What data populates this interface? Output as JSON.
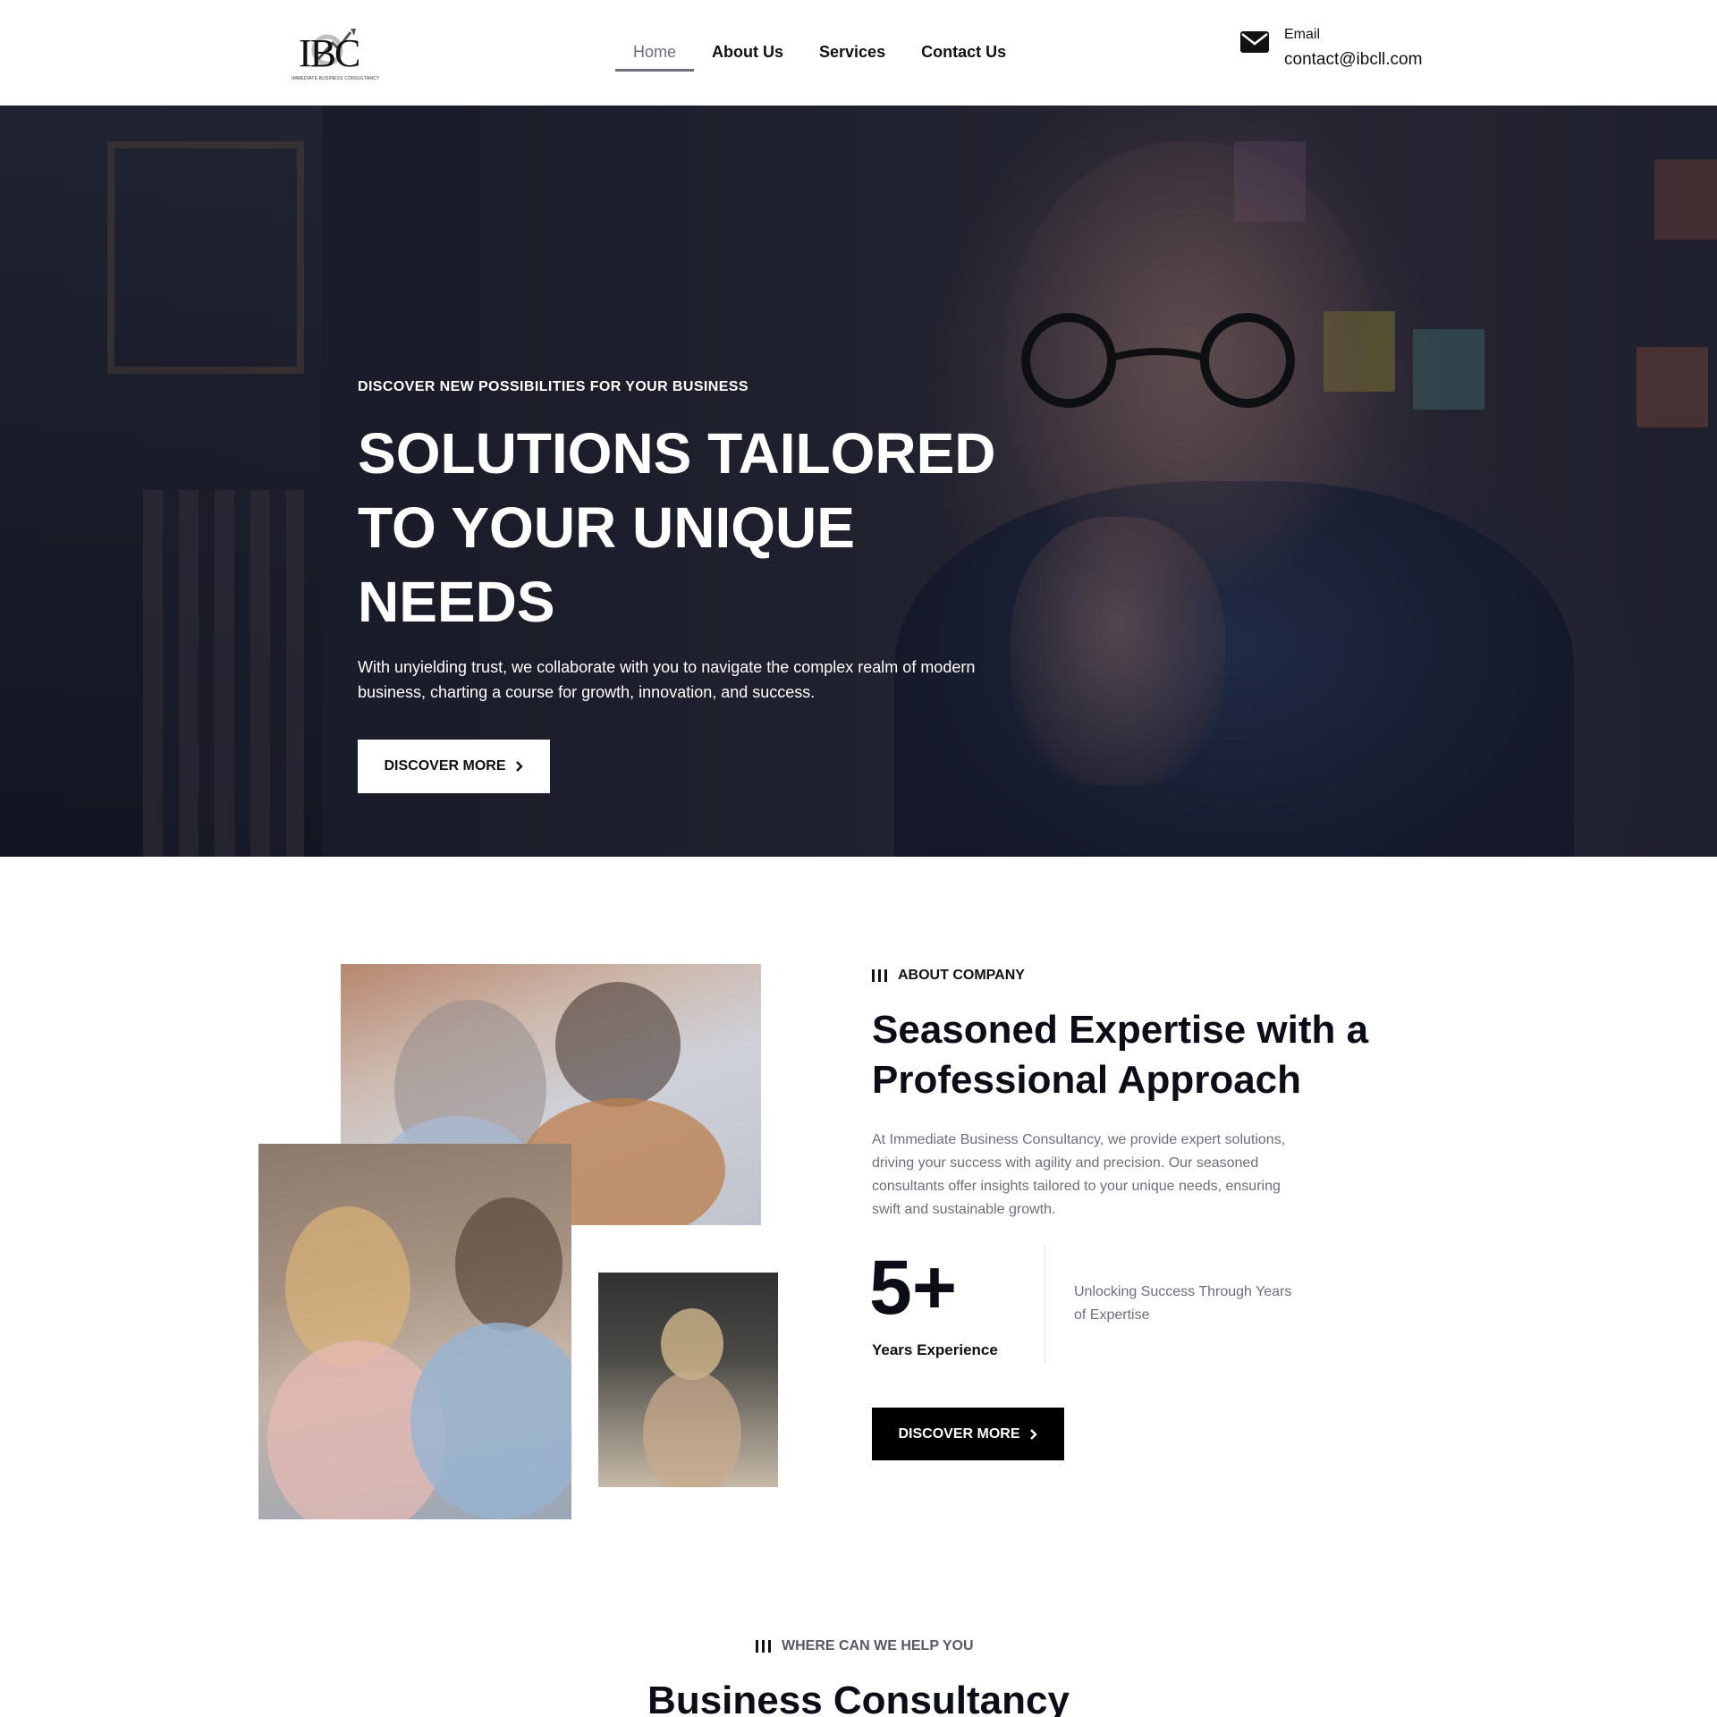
{
  "header": {
    "logo_text": "IBC",
    "logo_tagline": "IMMEDIATE BUSINESS CONSULTANCY",
    "nav": [
      {
        "label": "Home",
        "active": true
      },
      {
        "label": "About Us",
        "active": false
      },
      {
        "label": "Services",
        "active": false
      },
      {
        "label": "Contact Us",
        "active": false
      }
    ],
    "email_icon": "envelope-icon",
    "email_label": "Email",
    "email_value": "contact@ibcll.com"
  },
  "hero": {
    "eyebrow": "DISCOVER NEW POSSIBILITIES FOR YOUR BUSINESS",
    "title": "SOLUTIONS TAILORED TO YOUR UNIQUE NEEDS",
    "subtitle": "With unyielding trust, we collaborate with you to navigate the complex realm of modern business, charting a course for growth, innovation, and success.",
    "button_label": "DISCOVER MORE",
    "button_icon": "chevron-right-icon"
  },
  "about": {
    "eyebrow": "ABOUT COMPANY",
    "title": "Seasoned Expertise with a Professional Approach",
    "text": "At Immediate Business Consultancy, we provide expert solutions, driving your success with agility and precision. Our seasoned consultants offer insights tailored to your unique needs, ensuring swift and sustainable growth.",
    "stat_value": "5+",
    "stat_label": "Years Experience",
    "stat_description": "Unlocking Success Through Years of Expertise",
    "button_label": "DISCOVER MORE"
  },
  "services": {
    "eyebrow": "WHERE CAN WE HELP YOU",
    "title": "Business Consultancy"
  },
  "colors": {
    "text_dark": "#0b0d17",
    "muted": "#6b6f7a",
    "button_dark": "#000000",
    "button_light": "#ffffff"
  }
}
